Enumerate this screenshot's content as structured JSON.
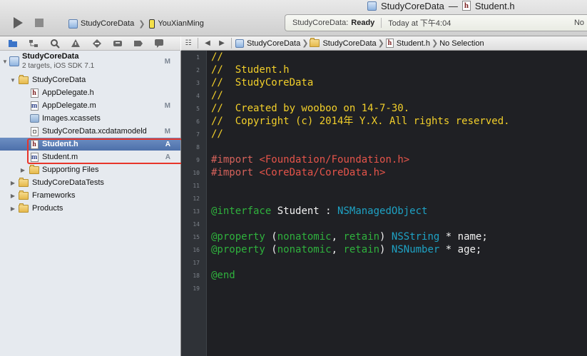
{
  "toolbar": {
    "scheme_project": "StudyCoreData",
    "scheme_device": "YouXianMing",
    "window_title_project": "StudyCoreData",
    "window_title_sep": "—",
    "window_title_file": "Student.h",
    "status_project": "StudyCoreData:",
    "status_state": "Ready",
    "status_time": "Today at 下午4:04",
    "status_extra": "No"
  },
  "navigator": {
    "items": [
      {
        "label": "StudyCoreData",
        "subtitle": "2 targets, iOS SDK 7.1",
        "badge": "M",
        "kind": "project",
        "expanded": true
      },
      {
        "label": "StudyCoreData",
        "badge": "",
        "kind": "folder",
        "expanded": true
      },
      {
        "label": "AppDelegate.h",
        "badge": "",
        "kind": "h"
      },
      {
        "label": "AppDelegate.m",
        "badge": "M",
        "kind": "m"
      },
      {
        "label": "Images.xcassets",
        "badge": "",
        "kind": "xcassets"
      },
      {
        "label": "StudyCoreData.xcdatamodeld",
        "badge": "M",
        "kind": "datamodel"
      },
      {
        "label": "Student.h",
        "badge": "A",
        "kind": "h",
        "selected": true
      },
      {
        "label": "Student.m",
        "badge": "A",
        "kind": "m"
      },
      {
        "label": "Supporting Files",
        "badge": "",
        "kind": "folder",
        "expanded": false
      },
      {
        "label": "StudyCoreDataTests",
        "badge": "",
        "kind": "folder",
        "expanded": false
      },
      {
        "label": "Frameworks",
        "badge": "",
        "kind": "folder",
        "expanded": false
      },
      {
        "label": "Products",
        "badge": "",
        "kind": "folder",
        "expanded": false
      }
    ]
  },
  "jumpbar": {
    "items": [
      "StudyCoreData",
      "StudyCoreData",
      "Student.h",
      "No Selection"
    ]
  },
  "editor": {
    "line_numbers": [
      "1",
      "2",
      "3",
      "4",
      "5",
      "6",
      "7",
      "8",
      "9",
      "10",
      "11",
      "12",
      "13",
      "14",
      "15",
      "16",
      "17",
      "18",
      "19"
    ],
    "lines": {
      "l1": "//",
      "l2": "//  Student.h",
      "l3": "//  StudyCoreData",
      "l4": "//",
      "l5": "//  Created by wooboo on 14-7-30.",
      "l6": "//  Copyright (c) 2014年 Y.X. All rights reserved.",
      "l7": "//",
      "l9_kw": "#import",
      "l9_str": "<Foundation/Foundation.h>",
      "l10_kw": "#import",
      "l10_str": "<CoreData/CoreData.h>",
      "l13_kw": "@interface",
      "l13_name": "Student :",
      "l13_type": "NSManagedObject",
      "l15_kw": "@property",
      "l15_p1": "(",
      "l15_a1": "nonatomic",
      "l15_p2": ", ",
      "l15_a2": "retain",
      "l15_p3": ")",
      "l15_type": "NSString",
      "l15_rest": "* name;",
      "l16_kw": "@property",
      "l16_p1": "(",
      "l16_a1": "nonatomic",
      "l16_p2": ", ",
      "l16_a2": "retain",
      "l16_p3": ")",
      "l16_type": "NSNumber",
      "l16_rest": "* age;",
      "l18_kw": "@end"
    }
  },
  "colors": {
    "editor_background": "#1f2024",
    "comment": "#f2cf2a",
    "directive": "#d6625b",
    "string": "#e5544a",
    "keyword": "#2fb13d",
    "type": "#1ea2c4",
    "selection": "#5a7cb5",
    "highlight_box": "#e8352a"
  }
}
